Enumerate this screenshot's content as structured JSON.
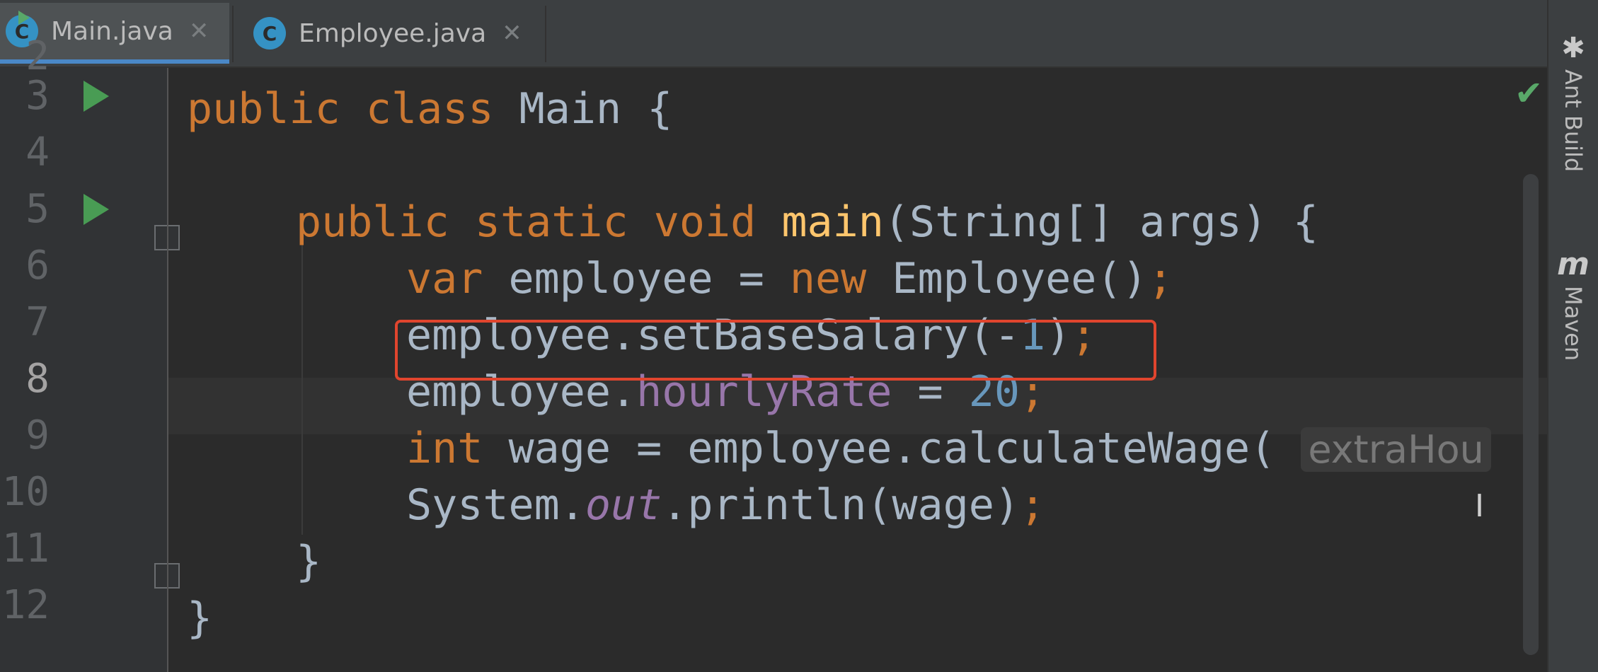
{
  "tabs": [
    {
      "label": "Main.java",
      "icon": "C",
      "active": true
    },
    {
      "label": "Employee.java",
      "icon": "C",
      "active": false
    }
  ],
  "tab_close_glyph": "✕",
  "gutter": {
    "line_numbers": [
      "2",
      "3",
      "4",
      "5",
      "6",
      "7",
      "8",
      "9",
      "10",
      "11",
      "12"
    ],
    "current_line": "8"
  },
  "code": {
    "line3": {
      "t1": "public class ",
      "t2": "Main {"
    },
    "line5": {
      "t1": "public static void ",
      "t2": "main",
      "t3": "(String[] args) {"
    },
    "line6": {
      "t1": "var ",
      "t2": "employee = ",
      "t3": "new ",
      "t4": "Employee()",
      "t5": ";"
    },
    "line7": {
      "t1": "employee.setBaseSalary(-",
      "t2": "1",
      "t3": ")",
      "t4": ";"
    },
    "line8": {
      "t1": "employee.",
      "t2": "hourlyRate",
      "t3": " = ",
      "t4": "20",
      "t5": ";"
    },
    "line9": {
      "t1": "int ",
      "t2": "wage = employee.calculateWage( ",
      "hint": "extraHou"
    },
    "line10": {
      "t1": "System.",
      "t2": "out",
      "t3": ".println(wage)",
      "t4": ";"
    },
    "line11": {
      "t1": "}"
    },
    "line12": {
      "t1": "}"
    }
  },
  "tool_strip": {
    "ant_build": "Ant Build",
    "maven": "Maven",
    "maven_icon": "m",
    "ant_icon": "✱"
  },
  "status": {
    "analysis_ok_icon": "✔",
    "cursor_glyph": "I"
  },
  "colors": {
    "keyword": "#cc7832",
    "method_decl": "#ffc66d",
    "number": "#6897bb",
    "field": "#9876aa",
    "highlight_box": "#e0452e"
  }
}
